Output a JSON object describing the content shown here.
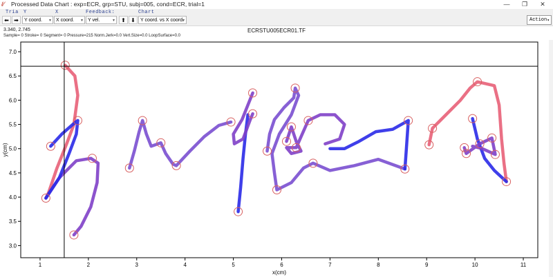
{
  "window": {
    "title": "Processed Data Chart : exp=ECR, grp=STU, subj=005, cond=ECR, trial=1",
    "app_icon": "chart-app-icon",
    "controls": [
      "minimize-icon",
      "restore-icon",
      "close-icon"
    ]
  },
  "toolbar": {
    "trial_label": "Tria",
    "y_label": "Y",
    "x_label": "X",
    "feedback_label": "Feedback:",
    "chart_label": "Chart",
    "y_select": "Y coord.",
    "x_select": "X coord.",
    "feedback_select": "Y vel.",
    "chart_select": "Y coord. vs X coord.",
    "action_select": "Action",
    "back_icon": "arrow-left-icon",
    "forward_icon": "arrow-right-icon",
    "up_icon": "arrow-up-icon",
    "down_icon": "arrow-down-icon"
  },
  "info": {
    "coords": "3.340, 2.745",
    "sample_line": "Sample= 0 Stroke= 0 Segment= 0 Pressure=215 Norm.Jerk=0.0 Vert.Size=0.0 LoopSurface=0.0",
    "file_name": "ECRSTU005ECR01.TF"
  },
  "colors": {
    "ink_blue": "#2a2ae8",
    "ink_purple": "#8040c8",
    "ink_pink": "#e86078",
    "marker": "#d86060"
  },
  "chart_data": {
    "type": "scatter",
    "title": "ECRSTU005ECR01.TF",
    "xlabel": "x(cm)",
    "ylabel": "y(cm)",
    "xlim": [
      0.6,
      11.3
    ],
    "ylim": [
      2.75,
      7.2
    ],
    "x_ticks": [
      "1",
      "2",
      "3",
      "4",
      "5",
      "6",
      "7",
      "8",
      "9",
      "10",
      "11"
    ],
    "y_ticks": [
      "3.0",
      "3.5",
      "4.0",
      "4.5",
      "5.0",
      "5.5",
      "6.0",
      "6.5",
      "7.0"
    ],
    "grid": false,
    "crosshair": {
      "x": 1.5,
      "y": 6.7
    },
    "markers": [
      {
        "x": 1.52,
        "y": 6.72
      },
      {
        "x": 1.22,
        "y": 5.05
      },
      {
        "x": 1.78,
        "y": 5.58
      },
      {
        "x": 1.12,
        "y": 3.98
      },
      {
        "x": 2.08,
        "y": 4.8
      },
      {
        "x": 1.7,
        "y": 3.22
      },
      {
        "x": 2.85,
        "y": 4.6
      },
      {
        "x": 3.12,
        "y": 5.58
      },
      {
        "x": 3.5,
        "y": 5.12
      },
      {
        "x": 3.82,
        "y": 4.65
      },
      {
        "x": 4.95,
        "y": 5.55
      },
      {
        "x": 5.4,
        "y": 5.72
      },
      {
        "x": 5.4,
        "y": 6.15
      },
      {
        "x": 5.1,
        "y": 3.7
      },
      {
        "x": 5.7,
        "y": 4.95
      },
      {
        "x": 6.28,
        "y": 6.25
      },
      {
        "x": 5.9,
        "y": 4.15
      },
      {
        "x": 6.2,
        "y": 5.45
      },
      {
        "x": 6.1,
        "y": 5.15
      },
      {
        "x": 6.3,
        "y": 5.02
      },
      {
        "x": 6.55,
        "y": 5.58
      },
      {
        "x": 6.65,
        "y": 4.7
      },
      {
        "x": 8.55,
        "y": 4.58
      },
      {
        "x": 8.62,
        "y": 5.58
      },
      {
        "x": 9.12,
        "y": 5.42
      },
      {
        "x": 9.05,
        "y": 5.08
      },
      {
        "x": 9.78,
        "y": 5.02
      },
      {
        "x": 9.82,
        "y": 4.9
      },
      {
        "x": 9.95,
        "y": 5.62
      },
      {
        "x": 10.1,
        "y": 5.1
      },
      {
        "x": 10.35,
        "y": 5.22
      },
      {
        "x": 10.42,
        "y": 4.88
      },
      {
        "x": 10.05,
        "y": 6.38
      },
      {
        "x": 10.65,
        "y": 4.32
      }
    ],
    "strokes": [
      {
        "color": "#e86078",
        "points": [
          [
            1.52,
            6.72
          ],
          [
            1.72,
            6.5
          ],
          [
            1.78,
            6.1
          ],
          [
            1.7,
            5.5
          ],
          [
            1.55,
            5.1
          ],
          [
            1.35,
            4.6
          ],
          [
            1.18,
            4.1
          ],
          [
            1.12,
            3.98
          ]
        ]
      },
      {
        "color": "#8040c8",
        "points": [
          [
            1.12,
            3.98
          ],
          [
            1.4,
            4.4
          ],
          [
            1.75,
            4.75
          ],
          [
            2.05,
            4.8
          ],
          [
            2.2,
            4.7
          ],
          [
            2.18,
            4.3
          ],
          [
            2.05,
            3.8
          ],
          [
            1.85,
            3.4
          ],
          [
            1.7,
            3.22
          ]
        ]
      },
      {
        "color": "#2a2ae8",
        "points": [
          [
            1.22,
            5.05
          ],
          [
            1.45,
            5.3
          ],
          [
            1.7,
            5.52
          ],
          [
            1.78,
            5.58
          ],
          [
            1.75,
            5.3
          ],
          [
            1.6,
            4.9
          ],
          [
            1.4,
            4.4
          ],
          [
            1.2,
            4.1
          ],
          [
            1.12,
            3.98
          ]
        ]
      },
      {
        "color": "#7a4fd0",
        "points": [
          [
            2.85,
            4.6
          ],
          [
            2.95,
            4.95
          ],
          [
            3.05,
            5.35
          ],
          [
            3.12,
            5.58
          ],
          [
            3.2,
            5.3
          ],
          [
            3.3,
            5.05
          ],
          [
            3.5,
            5.12
          ],
          [
            3.6,
            4.9
          ],
          [
            3.75,
            4.68
          ],
          [
            3.82,
            4.65
          ],
          [
            4.1,
            4.95
          ],
          [
            4.4,
            5.25
          ],
          [
            4.7,
            5.48
          ],
          [
            4.95,
            5.55
          ]
        ]
      },
      {
        "color": "#2a2ae8",
        "points": [
          [
            5.3,
            5.7
          ],
          [
            5.25,
            5.3
          ],
          [
            5.2,
            4.8
          ],
          [
            5.15,
            4.2
          ],
          [
            5.1,
            3.7
          ]
        ]
      },
      {
        "color": "#8040c8",
        "points": [
          [
            5.4,
            6.15
          ],
          [
            5.3,
            5.9
          ],
          [
            5.18,
            5.6
          ],
          [
            5.0,
            5.3
          ],
          [
            5.02,
            5.1
          ],
          [
            5.2,
            5.2
          ],
          [
            5.35,
            5.6
          ],
          [
            5.4,
            5.72
          ]
        ]
      },
      {
        "color": "#7a4fd0",
        "points": [
          [
            5.7,
            4.95
          ],
          [
            5.75,
            5.3
          ],
          [
            5.85,
            5.6
          ],
          [
            6.05,
            5.85
          ],
          [
            6.25,
            6.05
          ],
          [
            6.28,
            6.25
          ],
          [
            6.35,
            6.1
          ],
          [
            6.2,
            5.7
          ],
          [
            5.95,
            5.3
          ],
          [
            5.8,
            4.9
          ],
          [
            5.85,
            4.5
          ],
          [
            5.9,
            4.15
          ],
          [
            6.2,
            4.3
          ],
          [
            6.45,
            4.6
          ],
          [
            6.65,
            4.7
          ],
          [
            7.0,
            4.55
          ],
          [
            7.5,
            4.65
          ],
          [
            8.0,
            4.78
          ],
          [
            8.55,
            4.58
          ]
        ]
      },
      {
        "color": "#8040c8",
        "points": [
          [
            6.1,
            5.15
          ],
          [
            6.2,
            5.45
          ],
          [
            6.3,
            5.15
          ],
          [
            6.4,
            4.95
          ],
          [
            6.2,
            4.9
          ],
          [
            6.1,
            5.02
          ],
          [
            6.3,
            5.02
          ],
          [
            6.55,
            5.58
          ],
          [
            6.8,
            5.7
          ],
          [
            7.1,
            5.7
          ],
          [
            7.3,
            5.5
          ],
          [
            7.2,
            5.2
          ],
          [
            6.9,
            5.1
          ]
        ]
      },
      {
        "color": "#2a2ae8",
        "points": [
          [
            8.55,
            4.58
          ],
          [
            8.58,
            5.0
          ],
          [
            8.62,
            5.58
          ],
          [
            8.3,
            5.4
          ],
          [
            7.95,
            5.35
          ],
          [
            7.6,
            5.15
          ],
          [
            7.3,
            5.0
          ],
          [
            7.0,
            5.0
          ]
        ]
      },
      {
        "color": "#e86078",
        "points": [
          [
            9.05,
            5.08
          ],
          [
            9.12,
            5.42
          ],
          [
            9.4,
            5.7
          ],
          [
            9.7,
            6.0
          ],
          [
            9.9,
            6.25
          ],
          [
            10.05,
            6.38
          ],
          [
            10.4,
            6.3
          ],
          [
            10.5,
            5.9
          ],
          [
            10.55,
            5.2
          ],
          [
            10.6,
            4.7
          ],
          [
            10.65,
            4.32
          ]
        ]
      },
      {
        "color": "#2a2ae8",
        "points": [
          [
            9.95,
            5.62
          ],
          [
            10.05,
            5.2
          ],
          [
            10.2,
            4.8
          ],
          [
            10.4,
            4.55
          ],
          [
            10.65,
            4.32
          ]
        ]
      },
      {
        "color": "#8040c8",
        "points": [
          [
            9.78,
            5.02
          ],
          [
            9.82,
            4.9
          ],
          [
            10.1,
            5.1
          ],
          [
            10.35,
            5.22
          ],
          [
            10.42,
            4.88
          ],
          [
            10.15,
            5.0
          ],
          [
            9.95,
            5.05
          ]
        ]
      }
    ]
  }
}
